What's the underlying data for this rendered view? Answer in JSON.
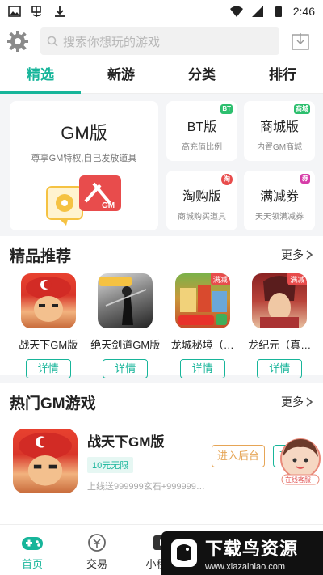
{
  "statusbar": {
    "time": "2:46"
  },
  "search": {
    "placeholder": "搜索你想玩的游戏"
  },
  "tabs": [
    "精选",
    "新游",
    "分类",
    "排行"
  ],
  "gm": {
    "big": {
      "title": "GM版",
      "subtitle": "尊享GM特权,自己发放道具",
      "icon_text": "GM"
    },
    "cards": [
      {
        "title": "BT版",
        "subtitle": "高充值比例",
        "badge": "BT",
        "badge_color": "#2dbf6e"
      },
      {
        "title": "商城版",
        "subtitle": "内置GM商城",
        "badge": "商城",
        "badge_color": "#2dbf6e"
      },
      {
        "title": "淘购版",
        "subtitle": "商城购买道具",
        "badge": "淘",
        "badge_color": "#e84c4c"
      },
      {
        "title": "满减券",
        "subtitle": "天天领满减券",
        "badge": "券",
        "badge_color": "#d63ca8"
      }
    ]
  },
  "recommend": {
    "title": "精品推荐",
    "more": "更多",
    "games": [
      {
        "name": "战天下GM版",
        "detail": "详情",
        "badge": ""
      },
      {
        "name": "绝天剑道GM版",
        "detail": "详情",
        "badge": ""
      },
      {
        "name": "龙城秘境（…",
        "detail": "详情",
        "badge": "满减"
      },
      {
        "name": "龙纪元（真…",
        "detail": "详情",
        "badge": "满减"
      }
    ]
  },
  "hot": {
    "title": "热门GM游戏",
    "more": "更多",
    "items": [
      {
        "name": "战天下GM版",
        "tag": "10元无限",
        "desc": "上线送999999玄石+999999…",
        "backstage": "进入后台",
        "download": "下载",
        "service": "在线客服"
      }
    ]
  },
  "nav": [
    {
      "label": "首页",
      "active": true
    },
    {
      "label": "交易",
      "active": false
    },
    {
      "label": "小程序",
      "active": false
    }
  ],
  "watermark": {
    "text": "下载鸟资源",
    "url": "www.xiazainiao.com"
  },
  "colors": {
    "accent": "#17b59a",
    "orange": "#e6a556",
    "red": "#e84c4c"
  }
}
